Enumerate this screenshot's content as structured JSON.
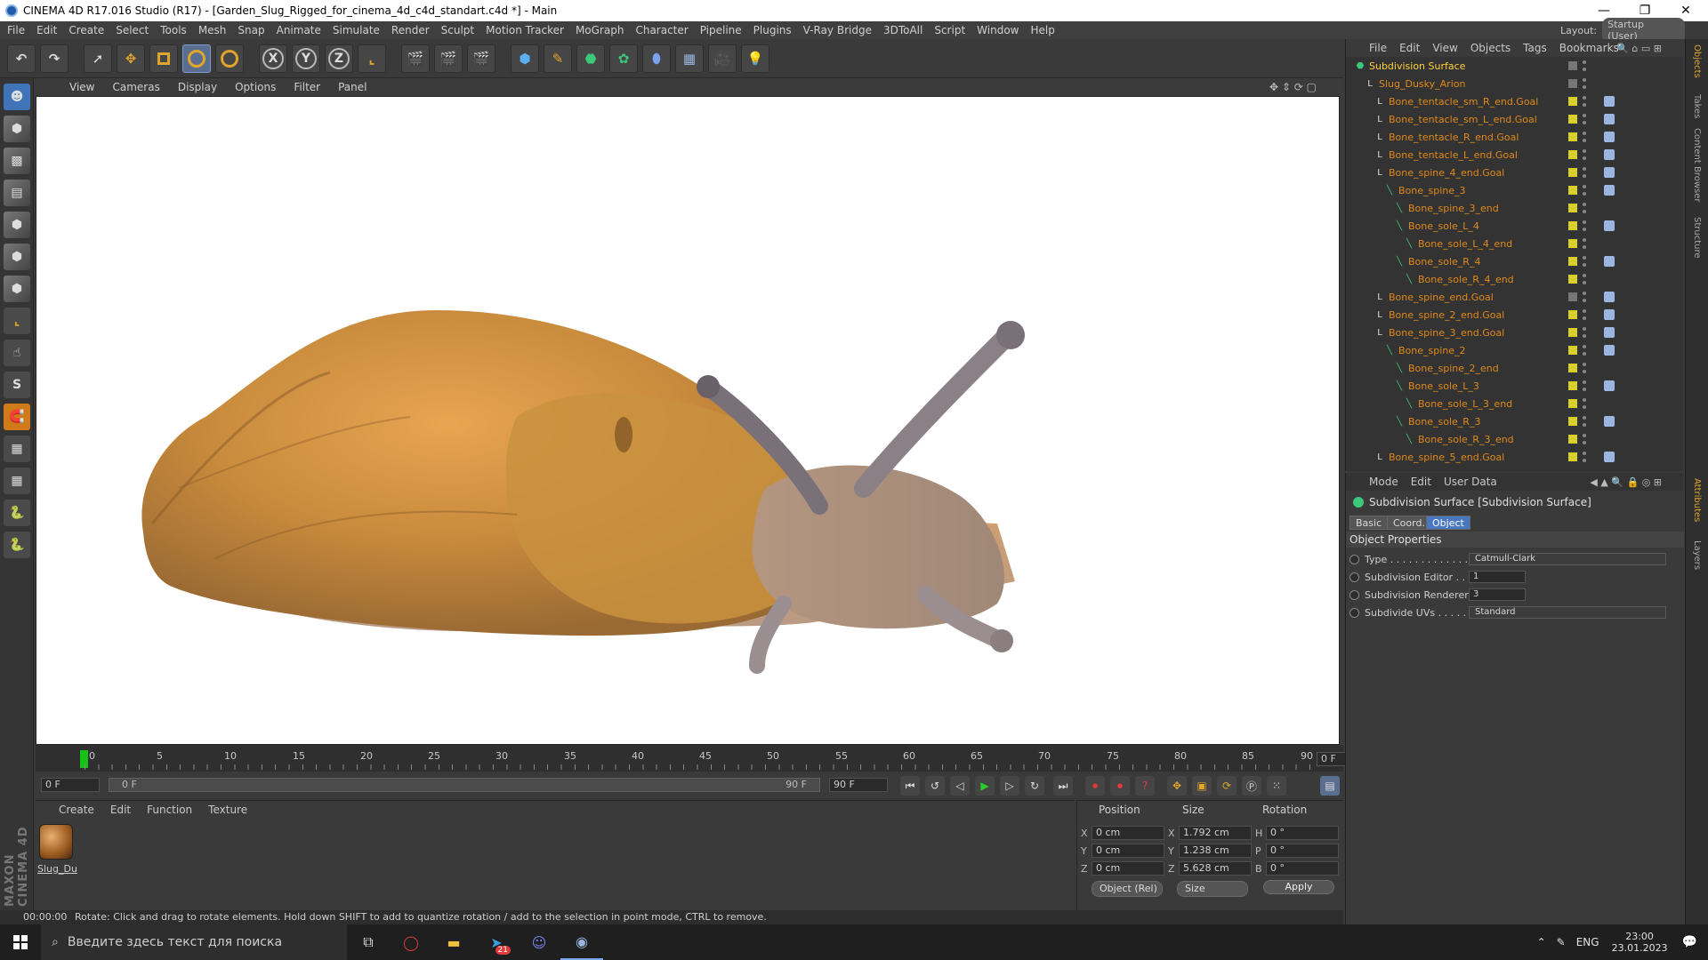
{
  "window": {
    "title": "CINEMA 4D R17.016 Studio (R17) - [Garden_Slug_Rigged_for_cinema_4d_c4d_standart.c4d *] - Main",
    "minimize": "—",
    "restore": "❐",
    "close": "✕"
  },
  "menu": [
    "File",
    "Edit",
    "Create",
    "Select",
    "Tools",
    "Mesh",
    "Snap",
    "Animate",
    "Simulate",
    "Render",
    "Sculpt",
    "Motion Tracker",
    "MoGraph",
    "Character",
    "Pipeline",
    "Plugins",
    "V-Ray Bridge",
    "3DToAll",
    "Script",
    "Window",
    "Help"
  ],
  "layout": {
    "label": "Layout:",
    "value": "Startup (User)"
  },
  "toolbar": {
    "x": "X",
    "y": "Y",
    "z": "Z"
  },
  "left_tools": {
    "s_label": "S"
  },
  "viewport_menu": [
    "View",
    "Cameras",
    "Display",
    "Options",
    "Filter",
    "Panel"
  ],
  "timeline": {
    "ticks": [
      "0",
      "5",
      "10",
      "15",
      "20",
      "25",
      "30",
      "35",
      "40",
      "45",
      "50",
      "55",
      "60",
      "65",
      "70",
      "75",
      "80",
      "85",
      "90"
    ],
    "current": "0 F",
    "start_field": "0 F",
    "range_start": "0 F",
    "range_end": "90 F",
    "end_field": "90 F"
  },
  "material_menu": [
    "Create",
    "Edit",
    "Function",
    "Texture"
  ],
  "material": {
    "label": "Slug_Du"
  },
  "coords": {
    "headers": [
      "Position",
      "Size",
      "Rotation"
    ],
    "rows": [
      {
        "axis": "X",
        "pos": "0 cm",
        "size_axis": "X",
        "size": "1.792 cm",
        "rot_axis": "H",
        "rot": "0 °"
      },
      {
        "axis": "Y",
        "pos": "0 cm",
        "size_axis": "Y",
        "size": "1.238 cm",
        "rot_axis": "P",
        "rot": "0 °"
      },
      {
        "axis": "Z",
        "pos": "0 cm",
        "size_axis": "Z",
        "size": "5.628 cm",
        "rot_axis": "B",
        "rot": "0 °"
      }
    ],
    "mode": "Object (Rel)",
    "size_mode": "Size",
    "apply": "Apply"
  },
  "status": {
    "time": "00:00:00",
    "message": "Rotate: Click and drag to rotate elements. Hold down SHIFT to add to quantize rotation / add to the selection in point mode, CTRL to remove."
  },
  "maxon": "MAXON CINEMA 4D",
  "object_menu": [
    "File",
    "Edit",
    "View",
    "Objects",
    "Tags",
    "Bookmarks"
  ],
  "objects": [
    {
      "name": "Subdivision Surface",
      "depth": 0,
      "selected": true
    },
    {
      "name": "Slug_Dusky_Arion",
      "depth": 1
    },
    {
      "name": "Bone_tentacle_sm_R_end.Goal",
      "depth": 2
    },
    {
      "name": "Bone_tentacle_sm_L_end.Goal",
      "depth": 2
    },
    {
      "name": "Bone_tentacle_R_end.Goal",
      "depth": 2
    },
    {
      "name": "Bone_tentacle_L_end.Goal",
      "depth": 2
    },
    {
      "name": "Bone_spine_4_end.Goal",
      "depth": 2
    },
    {
      "name": "Bone_spine_3",
      "depth": 3
    },
    {
      "name": "Bone_spine_3_end",
      "depth": 4
    },
    {
      "name": "Bone_sole_L_4",
      "depth": 4
    },
    {
      "name": "Bone_sole_L_4_end",
      "depth": 5
    },
    {
      "name": "Bone_sole_R_4",
      "depth": 4
    },
    {
      "name": "Bone_sole_R_4_end",
      "depth": 5
    },
    {
      "name": "Bone_spine_end.Goal",
      "depth": 2
    },
    {
      "name": "Bone_spine_2_end.Goal",
      "depth": 2
    },
    {
      "name": "Bone_spine_3_end.Goal",
      "depth": 2
    },
    {
      "name": "Bone_spine_2",
      "depth": 3
    },
    {
      "name": "Bone_spine_2_end",
      "depth": 4
    },
    {
      "name": "Bone_sole_L_3",
      "depth": 4
    },
    {
      "name": "Bone_sole_L_3_end",
      "depth": 5
    },
    {
      "name": "Bone_sole_R_3",
      "depth": 4
    },
    {
      "name": "Bone_sole_R_3_end",
      "depth": 5
    },
    {
      "name": "Bone_spine_5_end.Goal",
      "depth": 2
    }
  ],
  "attr_menu": [
    "Mode",
    "Edit",
    "User Data"
  ],
  "attributes": {
    "title": "Subdivision Surface [Subdivision Surface]",
    "tabs": [
      "Basic",
      "Coord.",
      "Object"
    ],
    "section": "Object Properties",
    "props": [
      {
        "label": "Type . . . . . . . . . . . . . .",
        "value": "Catmull-Clark",
        "kind": "dropdown"
      },
      {
        "label": "Subdivision Editor . .",
        "value": "1",
        "kind": "spinner"
      },
      {
        "label": "Subdivision Renderer",
        "value": "3",
        "kind": "spinner"
      },
      {
        "label": "Subdivide UVs . . . . . .",
        "value": "Standard",
        "kind": "dropdown"
      }
    ]
  },
  "right_strip": [
    "Objects",
    "Takes",
    "Content Browser",
    "Structure",
    "Attributes",
    "Layers"
  ],
  "taskbar": {
    "search_placeholder": "Введите здесь текст для поиска",
    "telegram_badge": "21",
    "lang": "ENG",
    "time": "23:00",
    "date": "23.01.2023"
  }
}
